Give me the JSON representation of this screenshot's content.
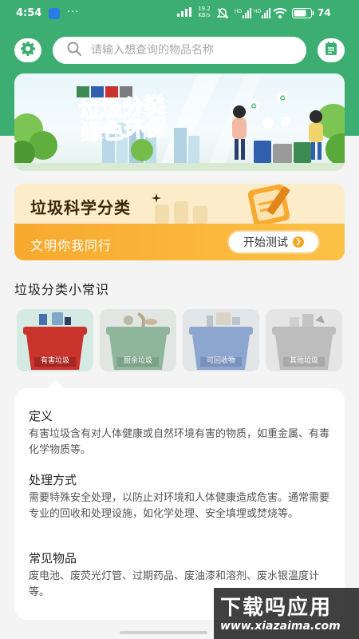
{
  "status_bar": {
    "time": "4:54",
    "more": "···",
    "net_speed_value": "19.2",
    "net_speed_unit": "KB/s",
    "battery_pct": "74"
  },
  "search": {
    "placeholder": "请输入想查询的物品名称"
  },
  "banner": {
    "icon": "garbage-sorting-banner-illustration"
  },
  "quiz": {
    "title": "垃圾科学分类",
    "slogan": "文明你我同行",
    "start_label": "开始测试"
  },
  "section_title": "垃圾分类小常识",
  "categories": [
    {
      "label": "有害垃圾",
      "color": "#c9342c",
      "selected": true
    },
    {
      "label": "厨余垃圾",
      "color": "#3d8a53",
      "selected": false
    },
    {
      "label": "可回收物",
      "color": "#2f5fae",
      "selected": false
    },
    {
      "label": "其他垃圾",
      "color": "#7c7c7c",
      "selected": false
    }
  ],
  "info": {
    "definition_heading": "定义",
    "definition_text": "有害垃圾含有对人体健康或自然环境有害的物质，如重金属、有毒化学物质等。",
    "handling_heading": "处理方式",
    "handling_text": "需要特殊安全处理，以防止对环境和人体健康造成危害。通常需要专业的回收和处理设施，如化学处理、安全填埋或焚烧等。",
    "items_heading": "常见物品",
    "items_text": "废电池、废荧光灯管、过期药品、废油漆和溶剂、废水银温度计等。"
  },
  "watermark": {
    "big": "下载吗应用",
    "small": "www.xiazaima.com"
  },
  "colors": {
    "brand_green": "#3dae72",
    "quiz_orange": "#f8a92e"
  }
}
